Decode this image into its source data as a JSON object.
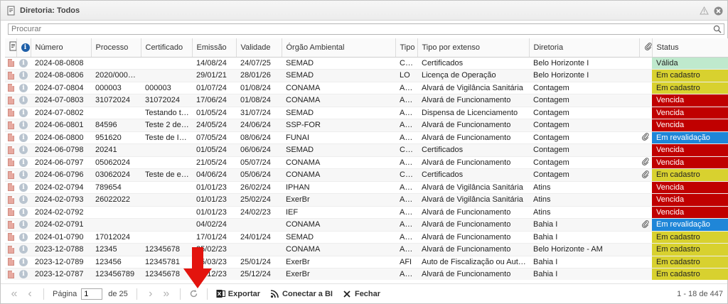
{
  "window": {
    "title": "Diretoria: Todos"
  },
  "search": {
    "placeholder": "Procurar"
  },
  "columns": [
    "Número",
    "Processo",
    "Certificado",
    "Emissão",
    "Validade",
    "Órgão Ambiental",
    "Tipo",
    "Tipo por extenso",
    "Diretoria",
    "Status"
  ],
  "rows": [
    {
      "numero": "2024-08-0808",
      "processo": "",
      "certificado": "",
      "emissao": "14/08/24",
      "validade": "24/07/25",
      "orgao": "SEMAD",
      "tipo": "CER",
      "tipo_extenso": "Certificados",
      "diretoria": "Belo Horizonte I",
      "attach": false,
      "status": "Válida",
      "status_kind": "valida"
    },
    {
      "numero": "2024-08-0806",
      "processo": "2020/00000...",
      "certificado": "",
      "emissao": "29/01/21",
      "validade": "28/01/26",
      "orgao": "SEMAD",
      "tipo": "LO",
      "tipo_extenso": "Licença de Operação",
      "diretoria": "Belo Horizonte I",
      "attach": false,
      "status": "Em cadastro",
      "status_kind": "cadastro"
    },
    {
      "numero": "2024-07-0804",
      "processo": "000003",
      "certificado": "000003",
      "emissao": "01/07/24",
      "validade": "01/08/24",
      "orgao": "CONAMA",
      "tipo": "AL...",
      "tipo_extenso": "Alvará de Vigilância Sanitária",
      "diretoria": "Contagem",
      "attach": false,
      "status": "Em cadastro",
      "status_kind": "cadastro"
    },
    {
      "numero": "2024-07-0803",
      "processo": "31072024",
      "certificado": "31072024",
      "emissao": "17/06/24",
      "validade": "01/08/24",
      "orgao": "CONAMA",
      "tipo": "AL...",
      "tipo_extenso": "Alvará de Funcionamento",
      "diretoria": "Contagem",
      "attach": false,
      "status": "Vencida",
      "status_kind": "vencida"
    },
    {
      "numero": "2024-07-0802",
      "processo": "",
      "certificado": "Testando te...",
      "emissao": "01/05/24",
      "validade": "31/07/24",
      "orgao": "SEMAD",
      "tipo": "AU...",
      "tipo_extenso": "Dispensa de Licenciamento",
      "diretoria": "Contagem",
      "attach": false,
      "status": "Vencida",
      "status_kind": "vencida"
    },
    {
      "numero": "2024-06-0801",
      "processo": "84596",
      "certificado": "Teste 2 de l...",
      "emissao": "24/05/24",
      "validade": "24/06/24",
      "orgao": "SSP-FOR",
      "tipo": "AL...",
      "tipo_extenso": "Alvará de Funcionamento",
      "diretoria": "Contagem",
      "attach": false,
      "status": "Vencida",
      "status_kind": "vencida"
    },
    {
      "numero": "2024-06-0800",
      "processo": "951620",
      "certificado": "Teste de ID ...",
      "emissao": "07/05/24",
      "validade": "08/06/24",
      "orgao": "FUNAI",
      "tipo": "AL...",
      "tipo_extenso": "Alvará de Funcionamento",
      "diretoria": "Contagem",
      "attach": true,
      "status": "Em revalidação",
      "status_kind": "revalidacao"
    },
    {
      "numero": "2024-06-0798",
      "processo": "20241",
      "certificado": "",
      "emissao": "01/05/24",
      "validade": "06/06/24",
      "orgao": "SEMAD",
      "tipo": "CER",
      "tipo_extenso": "Certificados",
      "diretoria": "Contagem",
      "attach": false,
      "status": "Vencida",
      "status_kind": "vencida"
    },
    {
      "numero": "2024-06-0797",
      "processo": "05062024",
      "certificado": "",
      "emissao": "21/05/24",
      "validade": "05/07/24",
      "orgao": "CONAMA",
      "tipo": "AL...",
      "tipo_extenso": "Alvará de Funcionamento",
      "diretoria": "Contagem",
      "attach": true,
      "status": "Vencida",
      "status_kind": "vencida"
    },
    {
      "numero": "2024-06-0796",
      "processo": "03062024",
      "certificado": "Teste de en...",
      "emissao": "04/06/24",
      "validade": "05/06/24",
      "orgao": "CONAMA",
      "tipo": "CER",
      "tipo_extenso": "Certificados",
      "diretoria": "Contagem",
      "attach": true,
      "status": "Em cadastro",
      "status_kind": "cadastro"
    },
    {
      "numero": "2024-02-0794",
      "processo": "789654",
      "certificado": "",
      "emissao": "01/01/23",
      "validade": "26/02/24",
      "orgao": "IPHAN",
      "tipo": "AL...",
      "tipo_extenso": "Alvará de Vigilância Sanitária",
      "diretoria": "Atins",
      "attach": false,
      "status": "Vencida",
      "status_kind": "vencida"
    },
    {
      "numero": "2024-02-0793",
      "processo": "26022022",
      "certificado": "",
      "emissao": "01/01/23",
      "validade": "25/02/24",
      "orgao": "ExerBr",
      "tipo": "AL...",
      "tipo_extenso": "Alvará de Vigilância Sanitária",
      "diretoria": "Atins",
      "attach": false,
      "status": "Vencida",
      "status_kind": "vencida"
    },
    {
      "numero": "2024-02-0792",
      "processo": "",
      "certificado": "",
      "emissao": "01/01/23",
      "validade": "24/02/23",
      "orgao": "IEF",
      "tipo": "AL...",
      "tipo_extenso": "Alvará de Funcionamento",
      "diretoria": "Atins",
      "attach": false,
      "status": "Vencida",
      "status_kind": "vencida"
    },
    {
      "numero": "2024-02-0791",
      "processo": "",
      "certificado": "",
      "emissao": "04/02/24",
      "validade": "",
      "orgao": "CONAMA",
      "tipo": "AL...",
      "tipo_extenso": "Alvará de Funcionamento",
      "diretoria": "Bahia I",
      "attach": true,
      "status": "Em revalidação",
      "status_kind": "revalidacao"
    },
    {
      "numero": "2024-01-0790",
      "processo": "17012024",
      "certificado": "",
      "emissao": "17/01/24",
      "validade": "24/01/24",
      "orgao": "SEMAD",
      "tipo": "AL...",
      "tipo_extenso": "Alvará de Funcionamento",
      "diretoria": "Bahia I",
      "attach": false,
      "status": "Em cadastro",
      "status_kind": "cadastro"
    },
    {
      "numero": "2023-12-0788",
      "processo": "12345",
      "certificado": "12345678",
      "emissao": "25/02/23",
      "validade": "",
      "orgao": "CONAMA",
      "tipo": "AL...",
      "tipo_extenso": "Alvará de Funcionamento",
      "diretoria": "Belo Horizonte - AM",
      "attach": false,
      "status": "Em cadastro",
      "status_kind": "cadastro"
    },
    {
      "numero": "2023-12-0789",
      "processo": "123456",
      "certificado": "12345781",
      "emissao": "25/03/23",
      "validade": "25/01/24",
      "orgao": "ExerBr",
      "tipo": "AFI",
      "tipo_extenso": "Auto de Fiscalização ou Auto de I...",
      "diretoria": "Bahia I",
      "attach": false,
      "status": "Em cadastro",
      "status_kind": "cadastro"
    },
    {
      "numero": "2023-12-0787",
      "processo": "123456789",
      "certificado": "12345678",
      "emissao": "25/12/23",
      "validade": "25/12/24",
      "orgao": "ExerBr",
      "tipo": "AL...",
      "tipo_extenso": "Alvará de Funcionamento",
      "diretoria": "Bahia I",
      "attach": false,
      "status": "Em cadastro",
      "status_kind": "cadastro"
    }
  ],
  "footer": {
    "page_label": "Página",
    "page_value": "1",
    "of_label": "de 25",
    "export_label": "Exportar",
    "bi_label": "Conectar a BI",
    "close_label": "Fechar",
    "counter": "1 - 18 de 447"
  },
  "colors": {
    "valida": "#bfe9cd",
    "cadastro": "#d8d12f",
    "vencida": "#c00000",
    "revalidacao": "#1f86d8",
    "arrow": "#e3140e"
  }
}
